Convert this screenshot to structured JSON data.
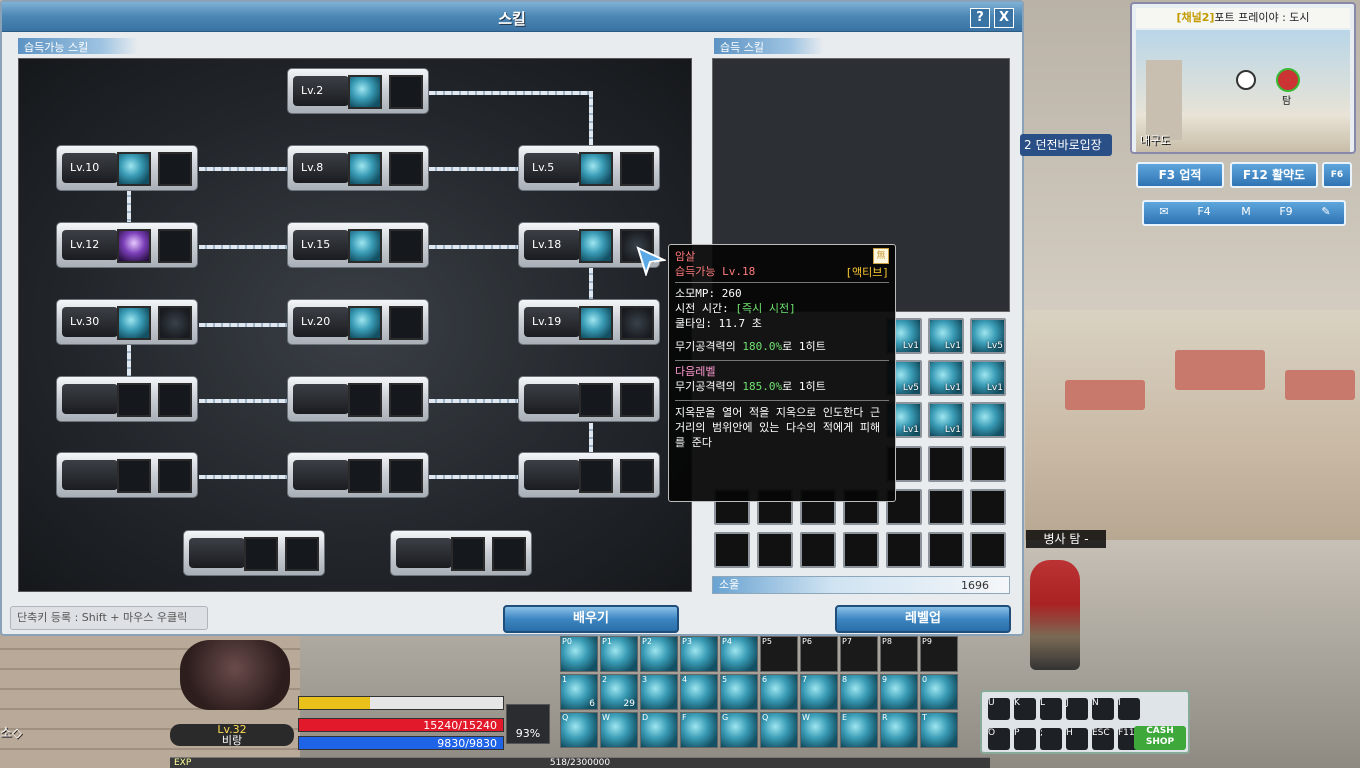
{
  "window": {
    "title": "스킬",
    "help_label": "?",
    "close_label": "X"
  },
  "left_section_label": "습득가능 스킬",
  "right_section_label": "습득 스킬",
  "skill_nodes": [
    {
      "id": "n1",
      "level": "Lv.2"
    },
    {
      "id": "n2",
      "level": "Lv.10"
    },
    {
      "id": "n3",
      "level": "Lv.8"
    },
    {
      "id": "n4",
      "level": "Lv.5"
    },
    {
      "id": "n5",
      "level": "Lv.12"
    },
    {
      "id": "n6",
      "level": "Lv.15"
    },
    {
      "id": "n7",
      "level": "Lv.18"
    },
    {
      "id": "n8",
      "level": "Lv.30"
    },
    {
      "id": "n9",
      "level": "Lv.20"
    },
    {
      "id": "n10",
      "level": "Lv.19"
    }
  ],
  "learned_tags": [
    "Lv1",
    "Lv1",
    "Lv5",
    "Lv5",
    "Lv1",
    "Lv1",
    "Lv1",
    "Lv1"
  ],
  "soul": {
    "label": "소울",
    "value": "1696"
  },
  "hint": "단축키 등록 : Shift + 마우스 우클릭",
  "learn_button": "배우기",
  "levelup_button": "레벨업",
  "tooltip": {
    "name": "암살",
    "learn_level": "습득가능 Lv.18",
    "badge": "無",
    "type": "[액티브]",
    "mp": "소모MP: 260",
    "cast_label": "시전 시간: ",
    "cast_value": "[즉시 시전]",
    "cooldown": "쿨타임: 11.7 초",
    "dmg_prefix": "무기공격력의 ",
    "dmg_value": "180.0%",
    "dmg_suffix": "로 1히트",
    "next_label": "다음레벨",
    "next_prefix": "무기공격력의 ",
    "next_value": "185.0%",
    "next_suffix": "로 1히트",
    "description": "지옥문을 열어 적을 지옥으로 인도한다 근거리의 범위안에 있는 다수의 적에게 피해를 준다"
  },
  "minimap": {
    "channel": "[채널2]",
    "location": "포트 프레이야 : 도시",
    "place": "내구도",
    "marker": "탐"
  },
  "dungeon_button": "2 던전바로입장",
  "achievement_button": "F3 업적",
  "activity_button": "F12 활약도",
  "f6_label": "F6",
  "toolbar": [
    "✉",
    "F4",
    "M",
    "F9",
    "✎"
  ],
  "player_name": "병사 탐 -",
  "hud": {
    "level": "Lv.32",
    "name": "비랑",
    "hp": "15240/15240",
    "mp": "9830/9830",
    "battery": "93%",
    "hp_fill": 1.0,
    "mp_fill": 1.0,
    "exp_fill": 0.35
  },
  "quickslot_keys": [
    "P0",
    "P1",
    "P2",
    "P3",
    "P4",
    "P5",
    "P6",
    "P7",
    "P8",
    "P9",
    "1",
    "2",
    "3",
    "4",
    "5",
    "6",
    "7",
    "8",
    "9",
    "0",
    "Q",
    "W",
    "D",
    "F",
    "G",
    "Q",
    "W",
    "E",
    "R",
    "T"
  ],
  "quickslot_counts": {
    "s10": "6",
    "s11": "29"
  },
  "menu_keys": [
    "U",
    "K",
    "L",
    "J",
    "N",
    "I",
    "O",
    "P",
    ";",
    "H",
    "ESC",
    "F11"
  ],
  "cash_shop": "CASH SHOP",
  "exp": {
    "label": "EXP",
    "value": "518/2300000"
  },
  "left_edge_text": "소◇"
}
